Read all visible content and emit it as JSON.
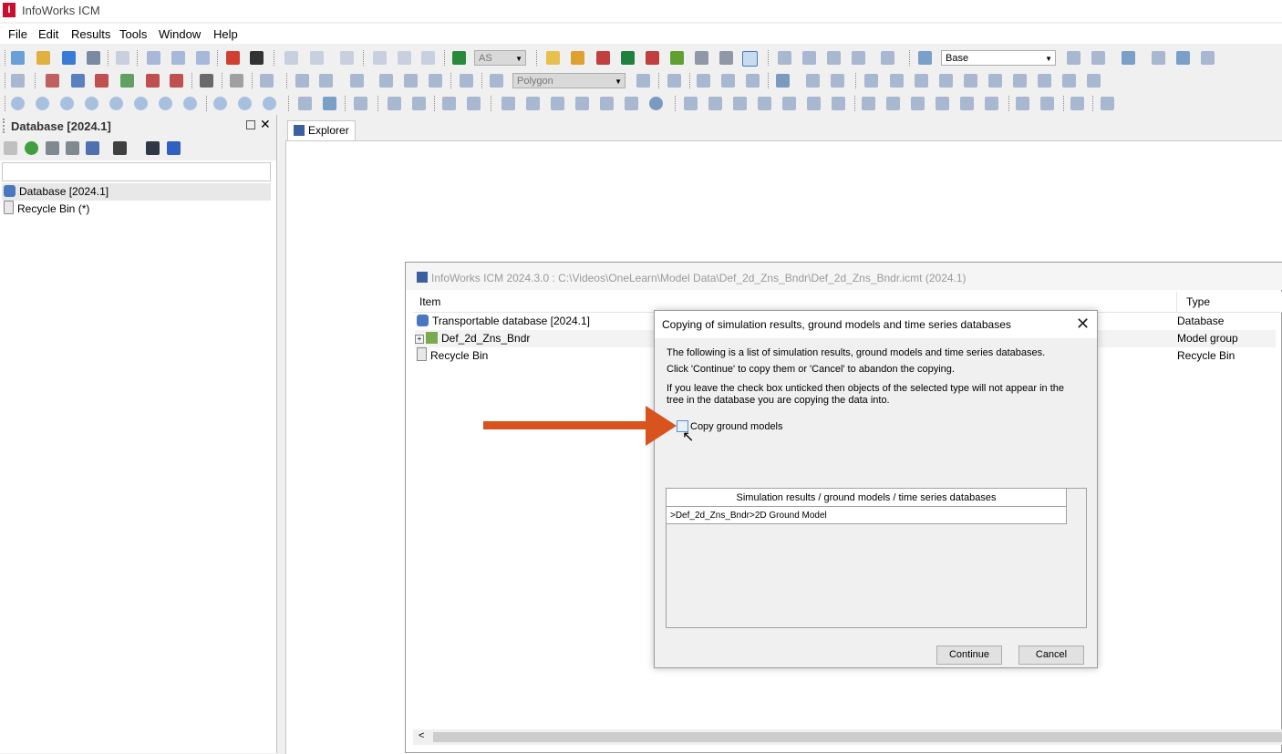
{
  "app": {
    "title": "InfoWorks ICM",
    "icon_letter": "I"
  },
  "menu": [
    "File",
    "Edit",
    "Results",
    "Tools",
    "Window",
    "Help"
  ],
  "toolbar": {
    "combo_as": "AS",
    "combo_base": "Base",
    "combo_polygon": "Polygon"
  },
  "left_panel": {
    "title": "Database [2024.1]",
    "tree": [
      {
        "label": "Database [2024.1]",
        "icon": "database-icon"
      },
      {
        "label": "Recycle Bin (*)",
        "icon": "recycle-bin-icon"
      }
    ]
  },
  "explorer": {
    "tab_label": "Explorer"
  },
  "db_window": {
    "title": "InfoWorks ICM 2024.3.0 : C:\\Videos\\OneLearn\\Model Data\\Def_2d_Zns_Bndr\\Def_2d_Zns_Bndr.icmt (2024.1)",
    "col_item": "Item",
    "col_type": "Type",
    "rows": [
      {
        "item": "Transportable database [2024.1]",
        "type": "Database"
      },
      {
        "item": "Def_2d_Zns_Bndr",
        "type": "Model group"
      },
      {
        "item": "Recycle Bin",
        "type": "Recycle Bin"
      }
    ]
  },
  "dialog": {
    "title": "Copying of simulation results, ground models and time series databases",
    "line1": "The following is a list of simulation results, ground models and time series databases.",
    "line2": "Click 'Continue' to copy them or 'Cancel' to abandon the copying.",
    "line3": "If you leave the check box unticked then objects of the selected type will not appear in the tree in the database you are copying the data into.",
    "checkbox_label": "Copy ground models",
    "grid_header": "Simulation results / ground models / time series databases",
    "grid_rows": [
      ">Def_2d_Zns_Bndr>2D Ground Model"
    ],
    "continue_label": "Continue",
    "cancel_label": "Cancel"
  },
  "colors": {
    "accent_arrow": "#d9531e",
    "brand_red": "#c8102e"
  }
}
